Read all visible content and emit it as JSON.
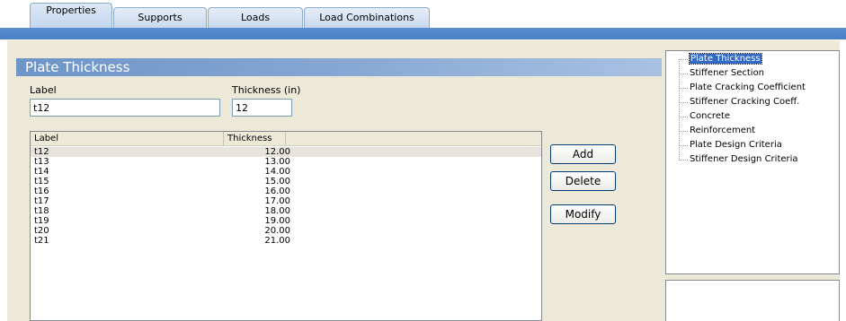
{
  "tabs": [
    {
      "label": "Properties",
      "active": true
    },
    {
      "label": "Supports",
      "active": false
    },
    {
      "label": "Loads",
      "active": false
    },
    {
      "label": "Load Combinations",
      "active": false
    }
  ],
  "section": {
    "title": "Plate Thickness"
  },
  "form": {
    "label_caption": "Label",
    "label_value": "t12",
    "thickness_caption": "Thickness (in)",
    "thickness_value": "12"
  },
  "list": {
    "columns": [
      "Label",
      "Thickness"
    ],
    "rows": [
      {
        "label": "t12",
        "thickness": "12.00",
        "selected": true
      },
      {
        "label": "t13",
        "thickness": "13.00"
      },
      {
        "label": "t14",
        "thickness": "14.00"
      },
      {
        "label": "t15",
        "thickness": "15.00"
      },
      {
        "label": "t16",
        "thickness": "16.00"
      },
      {
        "label": "t17",
        "thickness": "17.00"
      },
      {
        "label": "t18",
        "thickness": "18.00"
      },
      {
        "label": "t19",
        "thickness": "19.00"
      },
      {
        "label": "t20",
        "thickness": "20.00"
      },
      {
        "label": "t21",
        "thickness": "21.00"
      }
    ]
  },
  "buttons": {
    "add": "Add",
    "delete": "Delete",
    "modify": "Modify"
  },
  "tree": {
    "items": [
      "Plate Thickness",
      "Stiffener Section",
      "Plate Cracking Coefficient",
      "Stiffener Cracking Coeff.",
      "Concrete",
      "Reinforcement",
      "Plate Design Criteria",
      "Stiffener Design Criteria"
    ],
    "selected_index": 0
  },
  "colors": {
    "accent_blue": "#4a7fc6",
    "panel_bg": "#ece9d8",
    "selection": "#316ac5"
  }
}
